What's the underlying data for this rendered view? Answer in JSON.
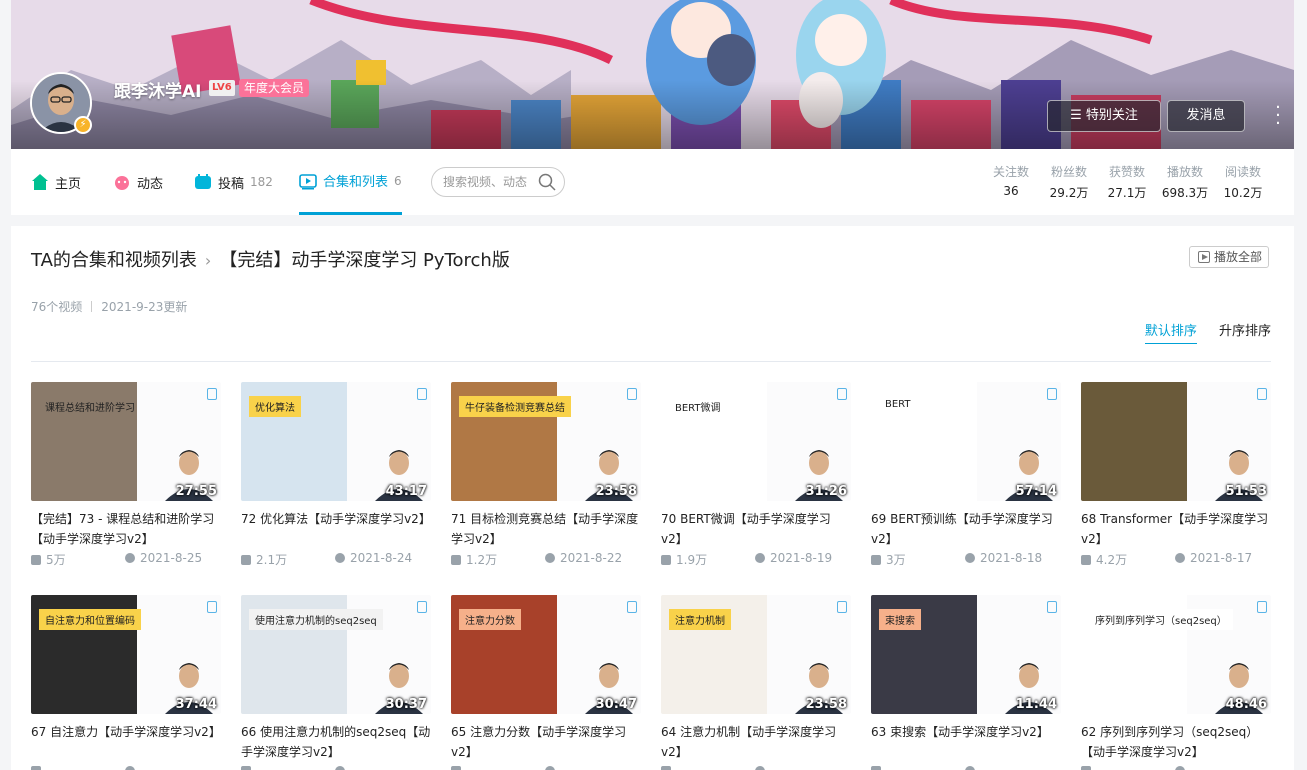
{
  "profile": {
    "name": "跟李沐学AI",
    "level": "LV6",
    "vip": "年度大会员",
    "follow_button": "特别关注",
    "message_button": "发消息"
  },
  "nav": {
    "home": "主页",
    "dynamic": "动态",
    "uploads": "投稿",
    "uploads_count": "182",
    "collections": "合集和列表",
    "collections_count": "6",
    "search_placeholder": "搜索视频、动态"
  },
  "stats": [
    {
      "label": "关注数",
      "value": "36"
    },
    {
      "label": "粉丝数",
      "value": "29.2万"
    },
    {
      "label": "获赞数",
      "value": "27.1万"
    },
    {
      "label": "播放数",
      "value": "698.3万"
    },
    {
      "label": "阅读数",
      "value": "10.2万"
    }
  ],
  "content": {
    "breadcrumb_root": "TA的合集和视频列表",
    "breadcrumb_sep": ">",
    "series_title": "【完结】动手学深度学习 PyTorch版",
    "play_all": "播放全部",
    "video_count": "76个视频",
    "updated": "2021-9-23更新",
    "sort_default": "默认排序",
    "sort_asc": "升序排序"
  },
  "videos": [
    {
      "tag": "课程总结和进阶学习",
      "duration": "27:55",
      "title": "【完结】73 - 课程总结和进阶学习【动手学深度学习v2】",
      "views": "5万",
      "date": "2021-8-25"
    },
    {
      "tag": "优化算法",
      "duration": "43:17",
      "title": "72 优化算法【动手学深度学习v2】",
      "views": "2.1万",
      "date": "2021-8-24"
    },
    {
      "tag": "牛仔装备检测竞赛总结",
      "duration": "23:58",
      "title": "71 目标检测竞赛总结【动手学深度学习v2】",
      "views": "1.2万",
      "date": "2021-8-22"
    },
    {
      "tag": "BERT微调",
      "duration": "31:26",
      "title": "70 BERT微调【动手学深度学习v2】",
      "views": "1.9万",
      "date": "2021-8-19"
    },
    {
      "tag": "BERT",
      "duration": "57:14",
      "title": "69 BERT预训练【动手学深度学习v2】",
      "views": "3万",
      "date": "2021-8-18"
    },
    {
      "tag": "",
      "duration": "51:53",
      "title": "68 Transformer【动手学深度学习v2】",
      "views": "4.2万",
      "date": "2021-8-17"
    },
    {
      "tag": "自注意力和位置编码",
      "duration": "37:44",
      "title": "67 自注意力【动手学深度学习v2】",
      "views": "",
      "date": ""
    },
    {
      "tag": "使用注意力机制的seq2seq",
      "duration": "30:37",
      "title": "66 使用注意力机制的seq2seq【动手学深度学习v2】",
      "views": "",
      "date": ""
    },
    {
      "tag": "注意力分数",
      "duration": "30:47",
      "title": "65 注意力分数【动手学深度学习v2】",
      "views": "",
      "date": ""
    },
    {
      "tag": "注意力机制",
      "duration": "23:58",
      "title": "64 注意力机制【动手学深度学习v2】",
      "views": "",
      "date": ""
    },
    {
      "tag": "束搜索",
      "duration": "11:44",
      "title": "63 束搜索【动手学深度学习v2】",
      "views": "",
      "date": ""
    },
    {
      "tag": "序列到序列学习（seq2seq）",
      "duration": "48:46",
      "title": "62 序列到序列学习（seq2seq）【动手学深度学习v2】",
      "views": "",
      "date": ""
    }
  ],
  "colors": {
    "accent": "#00a1d6",
    "vip_pink": "#fb7299",
    "muted": "#99a2aa"
  }
}
